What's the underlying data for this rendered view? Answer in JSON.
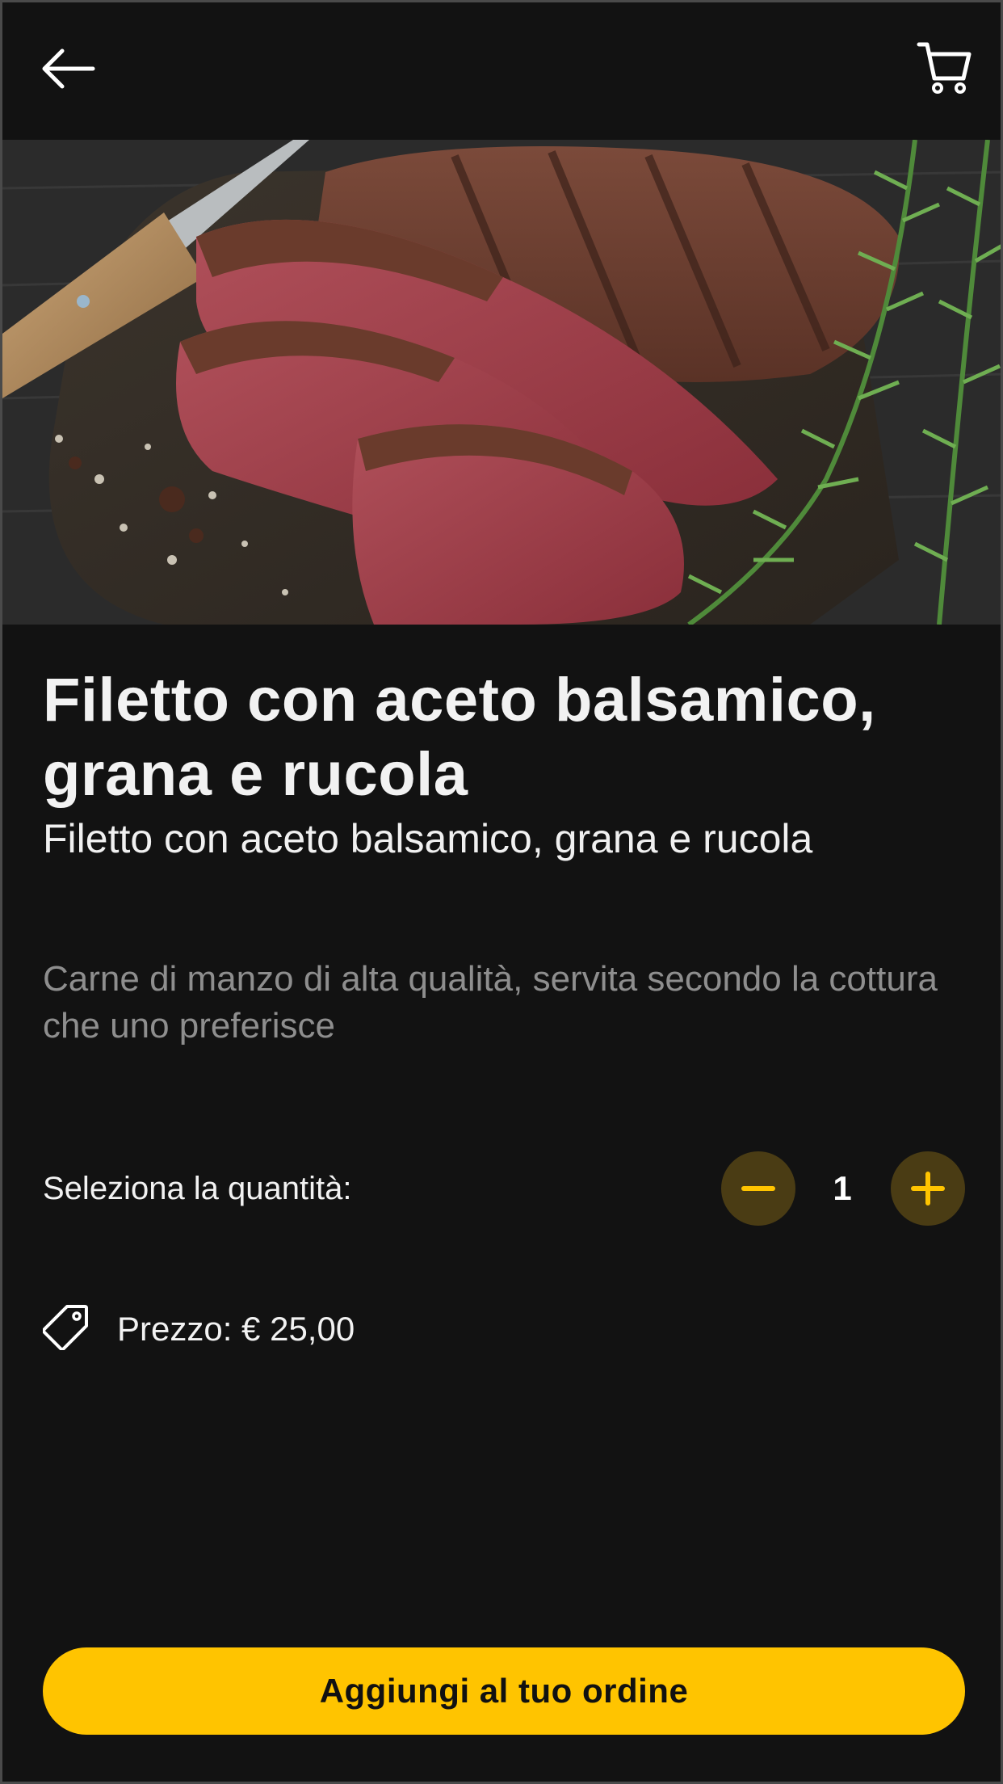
{
  "header": {
    "back_icon": "arrow-left-icon",
    "cart_icon": "shopping-cart-icon"
  },
  "product": {
    "image_alt": "steak-photo",
    "title": "Filetto con aceto balsamico, grana e rucola",
    "subtitle": "Filetto con aceto balsamico, grana e rucola",
    "description": "Carne di manzo di alta qualità, servita secondo la cottura che uno preferisce"
  },
  "quantity": {
    "label": "Seleziona la quantità:",
    "value": "1"
  },
  "price": {
    "icon": "price-tag-icon",
    "text": "Prezzo: € 25,00"
  },
  "cta": {
    "label": "Aggiungi al tuo ordine"
  },
  "colors": {
    "background": "#121212",
    "accent": "#ffc400",
    "qty_button_bg": "#4a3c14",
    "muted_text": "#8e8e8e"
  }
}
